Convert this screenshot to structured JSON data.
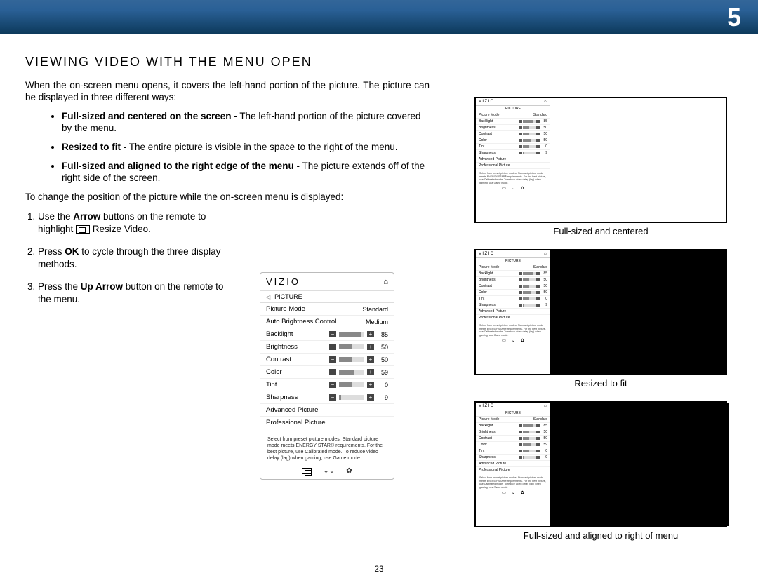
{
  "page": {
    "chapter_number": "5",
    "page_number": "23"
  },
  "heading": "VIEWING  VIDEO WITH THE MENU OPEN",
  "intro": "When the on-screen menu opens, it covers the left-hand portion of the picture. The picture can be displayed in three different ways:",
  "bullets": [
    {
      "term": "Full-sized and centered on the screen",
      "desc": " - The left-hand portion of the picture covered by the menu."
    },
    {
      "term": "Resized to fit",
      "desc": " - The entire picture is visible in the space to the right of the menu."
    },
    {
      "term": "Full-sized and aligned to the right edge of the menu",
      "desc": " - The picture extends off of the right side of the screen."
    }
  ],
  "para2": "To change the position of the picture while the on-screen menu is displayed:",
  "steps": [
    {
      "pre": "Use the ",
      "bold": "Arrow",
      "post": " buttons on the remote to highlight ",
      "tail": " Resize Video."
    },
    {
      "pre": "Press ",
      "bold": "OK",
      "post": " to cycle through the three display methods.",
      "tail": ""
    },
    {
      "pre": "Press the ",
      "bold": "Up Arrow",
      "post": " button on the remote to the menu.",
      "tail": ""
    }
  ],
  "menu": {
    "brand": "VIZIO",
    "section": "PICTURE",
    "rows": [
      {
        "label": "Picture Mode",
        "value": "Standard",
        "slider": null
      },
      {
        "label": "Auto Brightness Control",
        "value": "Medium",
        "slider": null
      },
      {
        "label": "Backlight",
        "value": "85",
        "slider": 85
      },
      {
        "label": "Brightness",
        "value": "50",
        "slider": 50
      },
      {
        "label": "Contrast",
        "value": "50",
        "slider": 50
      },
      {
        "label": "Color",
        "value": "59",
        "slider": 59
      },
      {
        "label": "Tint",
        "value": "0",
        "slider": 50
      },
      {
        "label": "Sharpness",
        "value": "9",
        "slider": 9
      },
      {
        "label": "Advanced Picture",
        "value": "",
        "slider": null
      },
      {
        "label": "Professional Picture",
        "value": "",
        "slider": null
      }
    ],
    "note": "Select from preset picture modes. Standard picture mode meets ENERGY STAR® requirements. For the best picture, use Calibrated mode. To reduce video delay (lag) when gaming, use Game mode."
  },
  "mini_rows": [
    {
      "label": "Picture Mode",
      "value": "Standard",
      "slider": null
    },
    {
      "label": "Backlight",
      "value": "85",
      "slider": 85
    },
    {
      "label": "Brightness",
      "value": "50",
      "slider": 50
    },
    {
      "label": "Contrast",
      "value": "50",
      "slider": 50
    },
    {
      "label": "Color",
      "value": "59",
      "slider": 59
    },
    {
      "label": "Tint",
      "value": "0",
      "slider": 50
    },
    {
      "label": "Sharpness",
      "value": "9",
      "slider": 9
    },
    {
      "label": "Advanced Picture",
      "value": "",
      "slider": null
    },
    {
      "label": "Professional Picture",
      "value": "",
      "slider": null
    }
  ],
  "mini_note": "Select from preset picture modes. Standard picture mode meets ENERGY STAR® requirements. For the best picture, use Calibrated mode. To reduce video delay (lag) when gaming, use Game mode.",
  "thumbs": [
    {
      "caption": "Full-sized and centered",
      "mode": "centered"
    },
    {
      "caption": "Resized to fit",
      "mode": "fit"
    },
    {
      "caption": "Full-sized and aligned to right of menu",
      "mode": "right"
    }
  ]
}
